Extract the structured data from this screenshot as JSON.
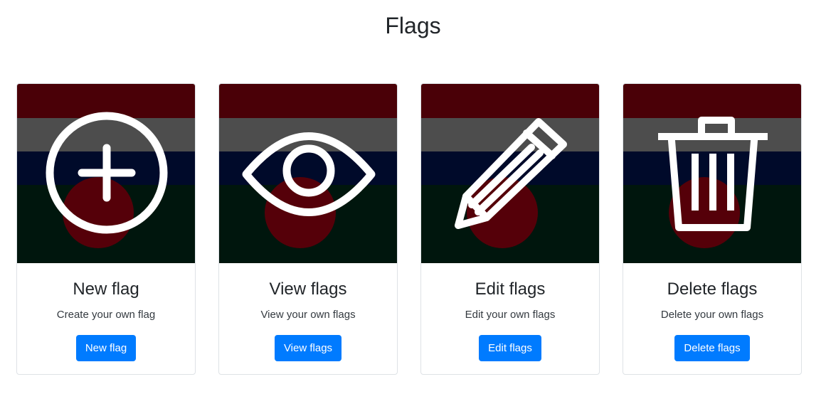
{
  "page": {
    "title": "Flags"
  },
  "flag_colors": {
    "band1": "#4a0007",
    "band2": "#4d4d4d",
    "band3": "#000a2a",
    "band4": "#00160d",
    "disc": "#550009",
    "icon": "#ffffff"
  },
  "cards": [
    {
      "icon": "plus-circle-icon",
      "title": "New flag",
      "text": "Create your own flag",
      "button": "New flag"
    },
    {
      "icon": "eye-icon",
      "title": "View flags",
      "text": "View your own flags",
      "button": "View flags"
    },
    {
      "icon": "pencil-icon",
      "title": "Edit flags",
      "text": "Edit your own flags",
      "button": "Edit flags"
    },
    {
      "icon": "trash-icon",
      "title": "Delete flags",
      "text": "Delete your own flags",
      "button": "Delete flags"
    }
  ],
  "accent": "#007bff"
}
